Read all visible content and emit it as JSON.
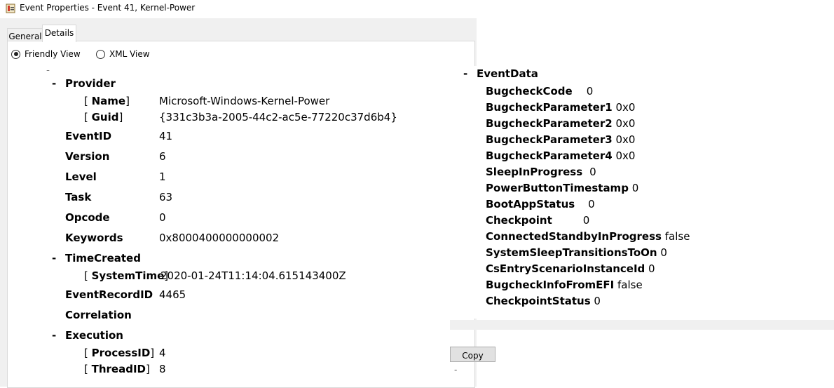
{
  "window": {
    "title": "Event Properties - Event 41, Kernel-Power"
  },
  "tabs": [
    {
      "label": "General"
    },
    {
      "label": "Details"
    }
  ],
  "view_options": [
    {
      "label": "Friendly View"
    },
    {
      "label": "XML View"
    }
  ],
  "system": {
    "provider_label": "Provider",
    "name_label": "Name",
    "name_value": "Microsoft-Windows-Kernel-Power",
    "guid_label": "Guid",
    "guid_value": "{331c3b3a-2005-44c2-ac5e-77220c37d6b4}",
    "eventid_label": "EventID",
    "eventid_value": "41",
    "version_label": "Version",
    "version_value": "6",
    "level_label": "Level",
    "level_value": "1",
    "task_label": "Task",
    "task_value": "63",
    "opcode_label": "Opcode",
    "opcode_value": "0",
    "keywords_label": "Keywords",
    "keywords_value": "0x8000400000000002",
    "timecreated_label": "TimeCreated",
    "systemtime_label": "SystemTime",
    "systemtime_value": "2020-01-24T11:14:04.615143400Z",
    "eventrecordid_label": "EventRecordID",
    "eventrecordid_value": "4465",
    "correlation_label": "Correlation",
    "execution_label": "Execution",
    "processid_label": "ProcessID",
    "processid_value": "4",
    "threadid_label": "ThreadID",
    "threadid_value": "8"
  },
  "event_data": {
    "header": "EventData",
    "items": [
      {
        "name": "BugcheckCode",
        "value": "0"
      },
      {
        "name": "BugcheckParameter1",
        "value": "0x0"
      },
      {
        "name": "BugcheckParameter2",
        "value": "0x0"
      },
      {
        "name": "BugcheckParameter3",
        "value": "0x0"
      },
      {
        "name": "BugcheckParameter4",
        "value": "0x0"
      },
      {
        "name": "SleepInProgress",
        "value": "0"
      },
      {
        "name": "PowerButtonTimestamp",
        "value": "0"
      },
      {
        "name": "BootAppStatus",
        "value": "0"
      },
      {
        "name": "Checkpoint",
        "value": "0"
      },
      {
        "name": "ConnectedStandbyInProgress",
        "value": "false"
      },
      {
        "name": "SystemSleepTransitionsToOn",
        "value": "0"
      },
      {
        "name": "CsEntryScenarioInstanceId",
        "value": "0"
      },
      {
        "name": "BugcheckInfoFromEFI",
        "value": "false"
      },
      {
        "name": "CheckpointStatus",
        "value": "0"
      }
    ]
  },
  "buttons": {
    "copy_label": "Copy"
  }
}
